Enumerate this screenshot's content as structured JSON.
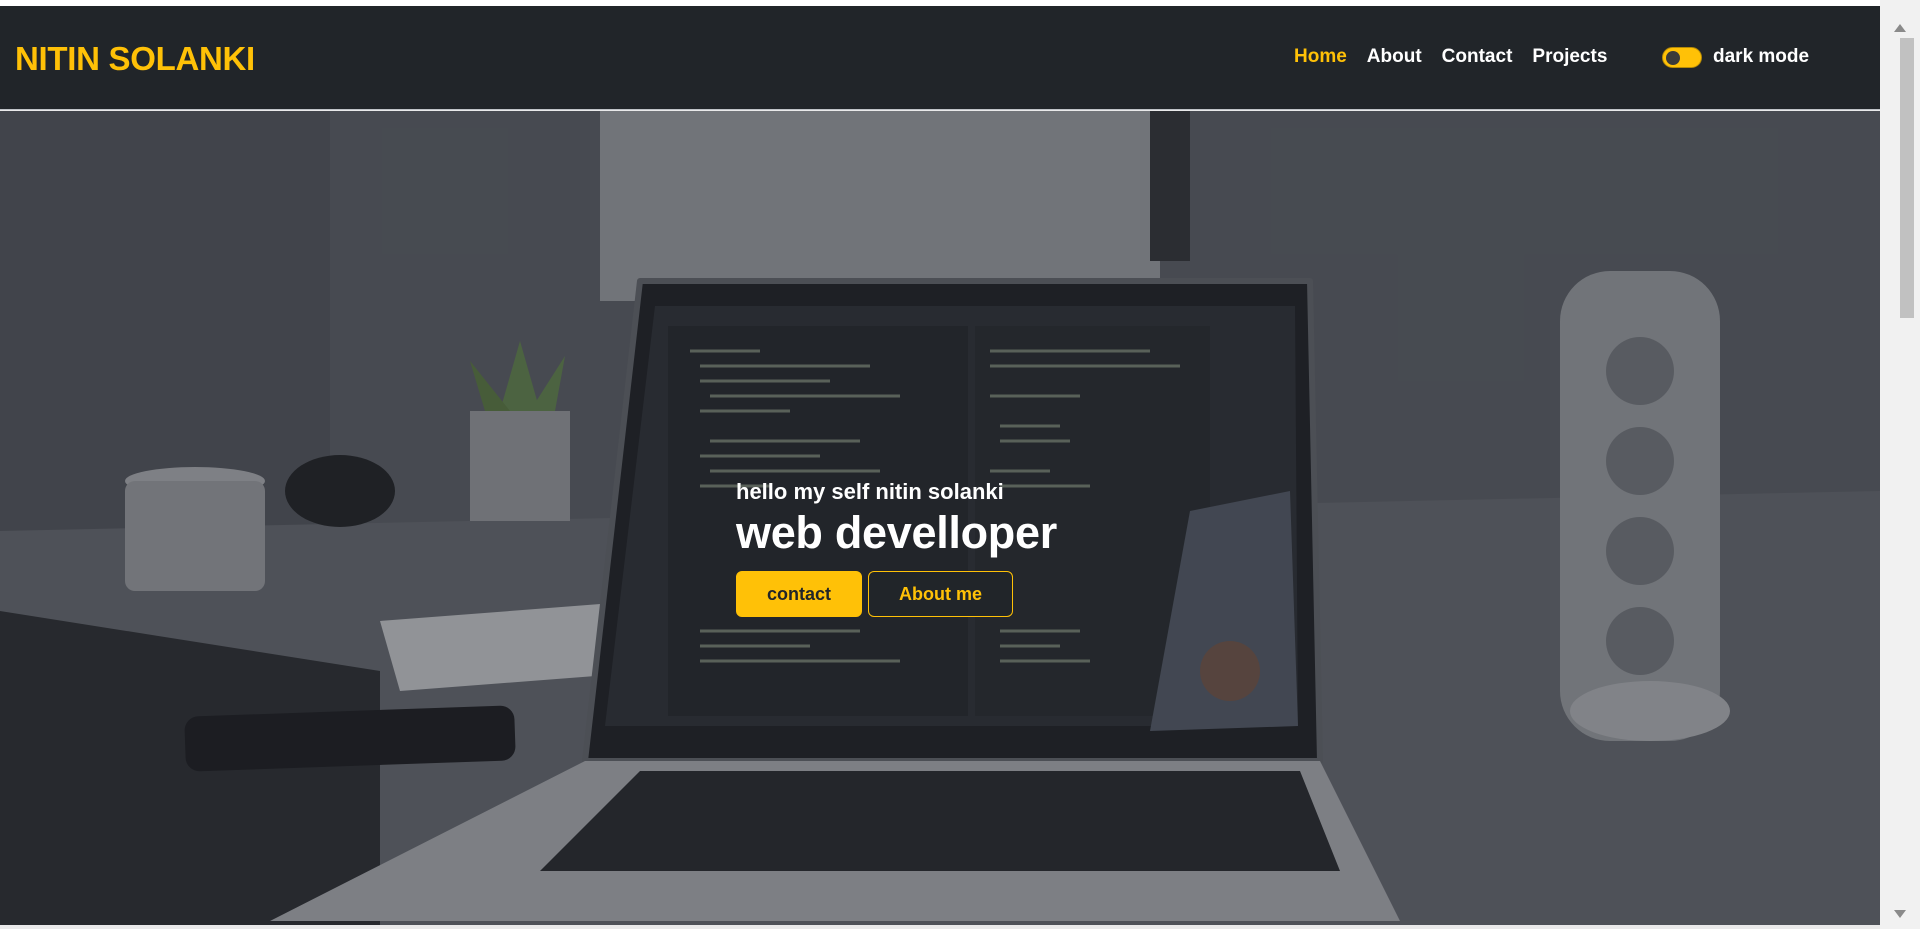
{
  "brand": {
    "name": "NITIN SOLANKI",
    "color": "#ffc107"
  },
  "nav": {
    "links": [
      {
        "label": "Home",
        "active": true
      },
      {
        "label": "About",
        "active": false
      },
      {
        "label": "Contact",
        "active": false
      },
      {
        "label": "Projects",
        "active": false
      }
    ]
  },
  "mode_toggle": {
    "label": "dark mode",
    "on": true
  },
  "hero": {
    "subtitle": "hello my self nitin solanki",
    "title": "web develloper",
    "buttons": {
      "contact": "contact",
      "about": "About me"
    },
    "background": "laptop-on-desk-photo"
  },
  "colors": {
    "accent": "#ffc107",
    "navbar": "#212529",
    "text": "#ffffff"
  }
}
